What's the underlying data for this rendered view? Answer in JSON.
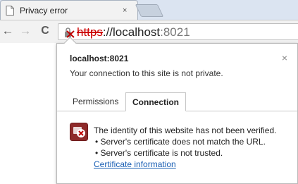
{
  "browser": {
    "tab": {
      "title": "Privacy error",
      "close_glyph": "×",
      "icon": "page-icon"
    },
    "nav": {
      "back_glyph": "←",
      "forward_glyph": "→",
      "reload_glyph": "C"
    },
    "address": {
      "scheme": "https",
      "rest": "://localhost",
      "port": ":8021",
      "icon": "broken-lock-icon"
    }
  },
  "popup": {
    "site": "localhost:8021",
    "status": "Your connection to this site is not private.",
    "close_glyph": "×",
    "tabs": [
      {
        "label": "Permissions",
        "selected": false
      },
      {
        "label": "Connection",
        "selected": true
      }
    ],
    "connection": {
      "icon": "certificate-error-icon",
      "heading": "The identity of this website has not been verified.",
      "bullets": [
        "• Server's certificate does not match the URL.",
        "• Server's certificate is not trusted."
      ],
      "link": "Certificate information"
    }
  },
  "colors": {
    "error_red": "#c00000",
    "link_blue": "#1a5fb4",
    "tabstrip": "#dbe4f1"
  }
}
